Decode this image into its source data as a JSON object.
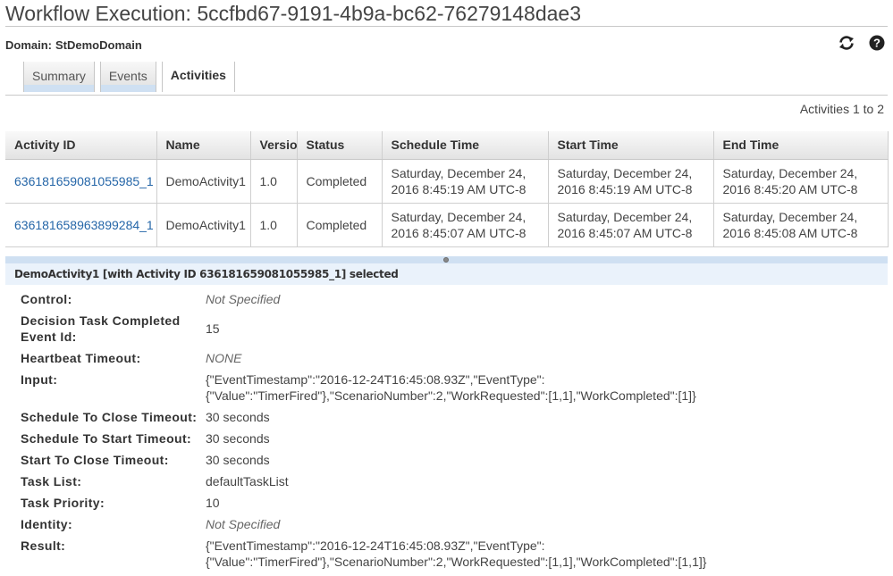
{
  "header": {
    "title": "Workflow Execution: 5ccfbd67-9191-4b9a-bc62-76279148dae3",
    "domain_label": "Domain:",
    "domain_value": "StDemoDomain",
    "icons": [
      "refresh-icon",
      "help-icon"
    ]
  },
  "tabs": [
    {
      "label": "Summary",
      "active": false
    },
    {
      "label": "Events",
      "active": false
    },
    {
      "label": "Activities",
      "active": true
    }
  ],
  "pagination": {
    "text": "Activities 1 to 2"
  },
  "table": {
    "columns": [
      "Activity ID",
      "Name",
      "Versio",
      "Status",
      "Schedule Time",
      "Start Time",
      "End Time"
    ],
    "rows": [
      {
        "activity_id": "636181659081055985_1",
        "name": "DemoActivity1",
        "version": "1.0",
        "status": "Completed",
        "schedule_time": "Saturday, December 24, 2016 8:45:19 AM UTC-8",
        "start_time": "Saturday, December 24, 2016 8:45:19 AM UTC-8",
        "end_time": "Saturday, December 24, 2016 8:45:20 AM UTC-8"
      },
      {
        "activity_id": "636181658963899284_1",
        "name": "DemoActivity1",
        "version": "1.0",
        "status": "Completed",
        "schedule_time": "Saturday, December 24, 2016 8:45:07 AM UTC-8",
        "start_time": "Saturday, December 24, 2016 8:45:07 AM UTC-8",
        "end_time": "Saturday, December 24, 2016 8:45:08 AM UTC-8"
      }
    ]
  },
  "selection": {
    "text": "DemoActivity1 [with Activity ID 636181659081055985_1] selected"
  },
  "details": {
    "control": {
      "label": "Control:",
      "value": "Not Specified"
    },
    "decision_task": {
      "label": "Decision Task Completed Event Id:",
      "value": "15"
    },
    "heartbeat": {
      "label": "Heartbeat Timeout:",
      "value": "NONE"
    },
    "input": {
      "label": "Input:",
      "value": "{\"EventTimestamp\":\"2016-12-24T16:45:08.93Z\",\"EventType\": {\"Value\":\"TimerFired\"},\"ScenarioNumber\":2,\"WorkRequested\":[1,1],\"WorkCompleted\":[1]}"
    },
    "schedule_to_close": {
      "label": "Schedule To Close Timeout:",
      "value": "30 seconds"
    },
    "schedule_to_start": {
      "label": "Schedule To Start Timeout:",
      "value": "30 seconds"
    },
    "start_to_close": {
      "label": "Start To Close Timeout:",
      "value": "30 seconds"
    },
    "task_list": {
      "label": "Task List:",
      "value": "defaultTaskList"
    },
    "task_priority": {
      "label": "Task Priority:",
      "value": "10"
    },
    "identity": {
      "label": "Identity:",
      "value": "Not Specified"
    },
    "result": {
      "label": "Result:",
      "value": "{\"EventTimestamp\":\"2016-12-24T16:45:08.93Z\",\"EventType\": {\"Value\":\"TimerFired\"},\"ScenarioNumber\":2,\"WorkRequested\":[1,1],\"WorkCompleted\":[1,1]}"
    }
  },
  "colors": {
    "link": "#2566a8",
    "accent_blue_light": "#cfe0f2",
    "selection_bg": "#eaf2fb"
  }
}
